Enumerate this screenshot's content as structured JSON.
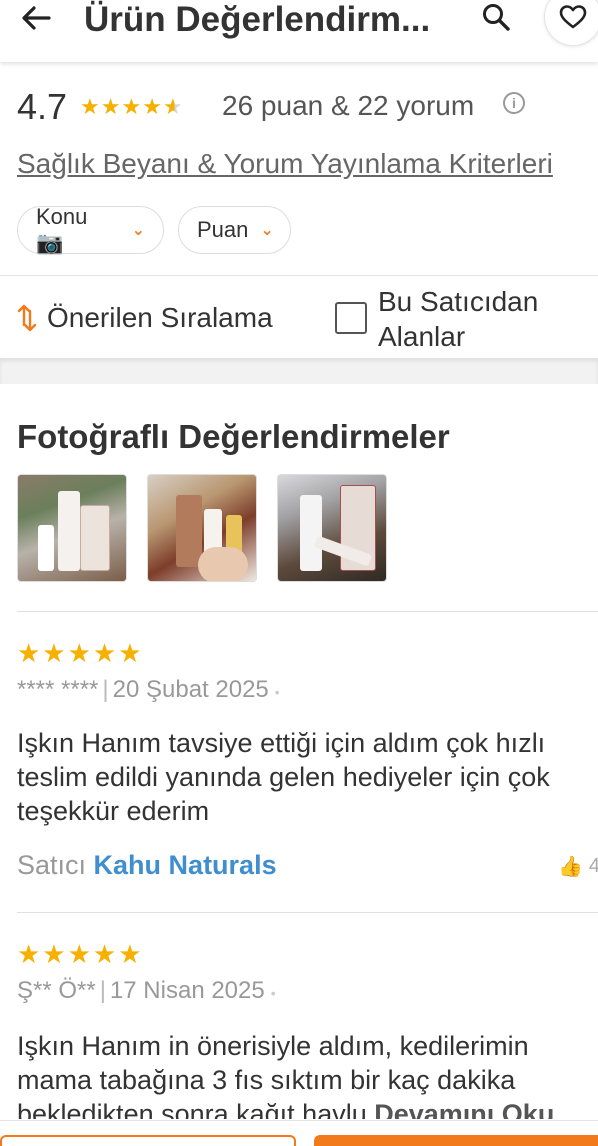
{
  "header": {
    "title": "Ürün Değerlendirm...",
    "back_icon": "arrow-left-icon",
    "search_icon": "search-icon",
    "favorite_icon": "heart-icon"
  },
  "summary": {
    "rating": "4.7",
    "stars_filled": 4.5,
    "counts": "26 puan & 22 yorum",
    "criteria_link": "Sağlık Beyanı & Yorum Yayınlama Kriterleri",
    "filters": [
      {
        "label": "Konu 📷"
      },
      {
        "label": "Puan"
      }
    ],
    "sort_label": "Önerilen Sıralama",
    "seller_only_label": "Bu Satıcıdan Alanlar",
    "seller_only_checked": false
  },
  "photos": {
    "title": "Fotoğraflı Değerlendirmeler",
    "count": 3
  },
  "reviews": [
    {
      "stars": "★★★★★",
      "author": "**** ****",
      "date": "20 Şubat 2025",
      "text": "Işkın Hanım tavsiye ettiği için aldım çok hızlı teslim edildi yanında gelen hediyeler için çok teşekkür ederim",
      "seller_prefix": "Satıcı",
      "seller_name": "Kahu Naturals",
      "likes": "4"
    },
    {
      "stars": "★★★★★",
      "author": "Ş** Ö**",
      "date": "17 Nisan 2025",
      "text": "Işkın Hanım in önerisiyle aldım, kedilerimin mama tabağına 3 fıs sıktım bir kaç dakika bekledikten sonra kağıt havlu",
      "read_more": "Devamını Oku"
    }
  ],
  "colors": {
    "accent": "#f27a1a",
    "star": "#f6b100",
    "seller_link": "#3f8ed0"
  }
}
